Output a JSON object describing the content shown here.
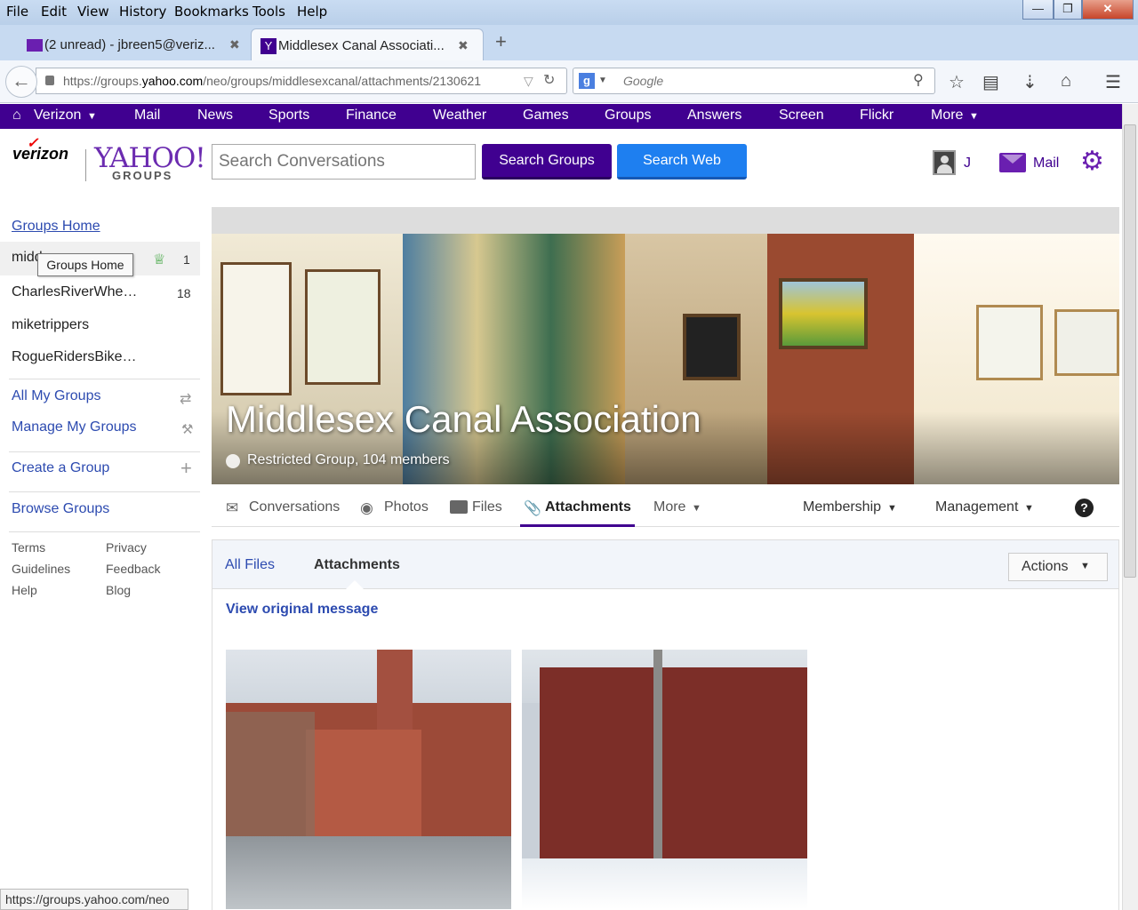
{
  "browser": {
    "menu": [
      "File",
      "Edit",
      "View",
      "History",
      "Bookmarks",
      "Tools",
      "Help"
    ],
    "tabs": [
      {
        "title": "(2 unread) - jbreen5@veriz..."
      },
      {
        "title": "Middlesex Canal Associati..."
      }
    ],
    "url_prefix": "https://groups.",
    "url_host": "yahoo.com",
    "url_rest": "/neo/groups/middlesexcanal/attachments/2130621",
    "search_placeholder": "Google",
    "status_url": "https://groups.yahoo.com/neo"
  },
  "ybar": {
    "items": [
      "Verizon",
      "Mail",
      "News",
      "Sports",
      "Finance",
      "Weather",
      "Games",
      "Groups",
      "Answers",
      "Screen",
      "Flickr",
      "More"
    ]
  },
  "header": {
    "logo_verizon": "verizon",
    "logo_yahoo": "YAHOO!",
    "logo_groups": "GROUPS",
    "search_placeholder": "Search Conversations",
    "btn_search_groups": "Search Groups",
    "btn_search_web": "Search Web",
    "user_initial": "J",
    "mail_label": "Mail"
  },
  "sidebar": {
    "groups_home": "Groups Home",
    "groups": [
      {
        "name": "midd",
        "count": "1"
      },
      {
        "name": "CharlesRiverWhe…",
        "count": "18"
      },
      {
        "name": "miketrippers",
        "count": ""
      },
      {
        "name": "RogueRidersBike…",
        "count": ""
      }
    ],
    "all_my_groups": "All My Groups",
    "manage_my_groups": "Manage My Groups",
    "create_group": "Create a Group",
    "browse_groups": "Browse Groups",
    "footer": [
      "Terms",
      "Privacy",
      "Guidelines",
      "Feedback",
      "Help",
      "Blog"
    ],
    "tooltip": "Groups Home"
  },
  "group": {
    "title": "Middlesex Canal Association",
    "subtitle": "Restricted Group, 104 members",
    "tabs": [
      "Conversations",
      "Photos",
      "Files",
      "Attachments",
      "More"
    ],
    "membership": "Membership",
    "management": "Management",
    "help": "?"
  },
  "files": {
    "all_files": "All Files",
    "attachments": "Attachments",
    "actions": "Actions",
    "view_original": "View original message"
  }
}
